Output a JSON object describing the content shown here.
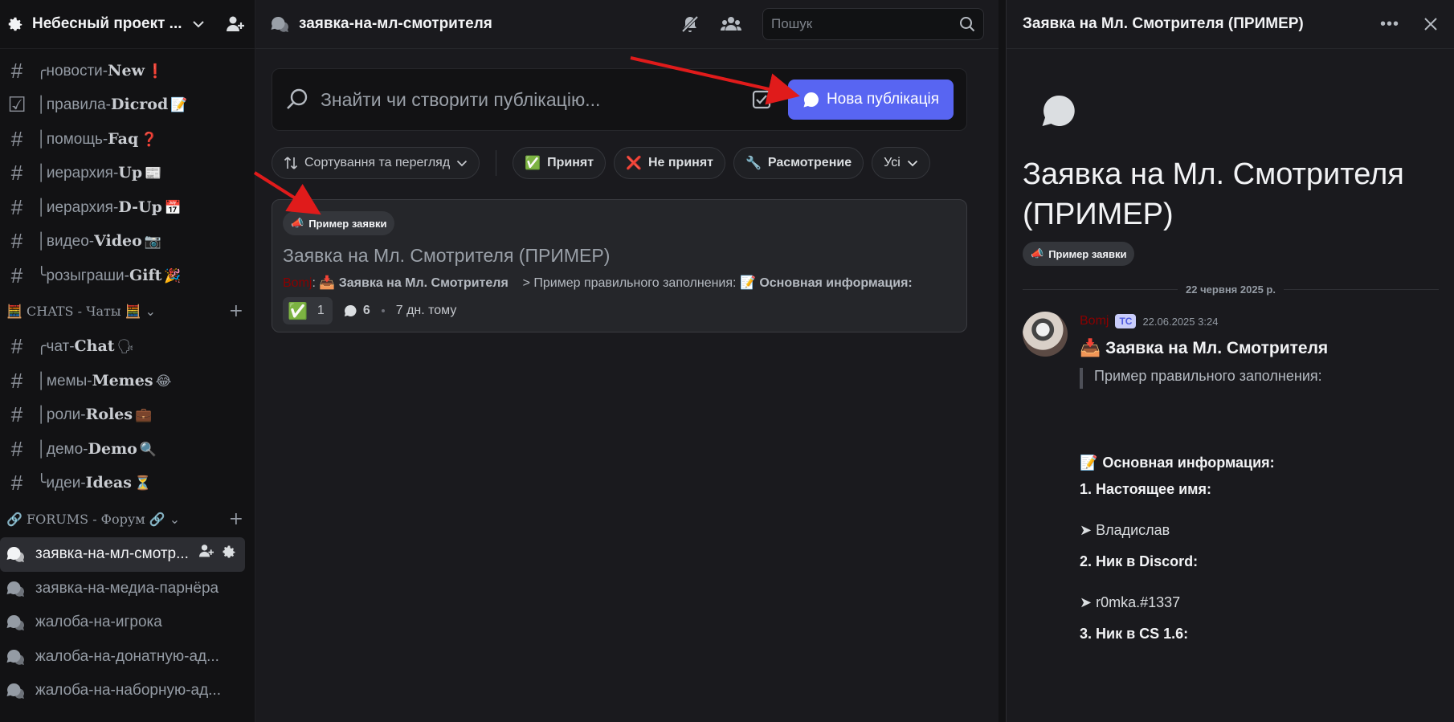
{
  "server": {
    "name": "Небесный проект ..."
  },
  "channels_top": [
    {
      "prefix": "╭",
      "name": "новости-",
      "bold": "New",
      "emoji": "❗"
    },
    {
      "prefix": "│",
      "name": "правила-",
      "bold": "Dicrod",
      "emoji": "📝",
      "icon": "rules"
    },
    {
      "prefix": "│",
      "name": "помощь-",
      "bold": "Faq",
      "emoji": "❓"
    },
    {
      "prefix": "│",
      "name": "иерархия-",
      "bold": "Up",
      "emoji": "📰"
    },
    {
      "prefix": "│",
      "name": "иерархия-",
      "bold": "D-Up",
      "emoji": "📅"
    },
    {
      "prefix": "│",
      "name": "видео-",
      "bold": "Video",
      "emoji": "📷"
    },
    {
      "prefix": "╰",
      "name": "розыграши-",
      "bold": "Gift",
      "emoji": "🎉"
    }
  ],
  "category_chats": {
    "label": "🧮 CHATS - Чаты 🧮 ⌄"
  },
  "channels_chats": [
    {
      "prefix": "╭",
      "name": "чат-",
      "bold": "Chat",
      "emoji": "🗣"
    },
    {
      "prefix": "│",
      "name": "мемы-",
      "bold": "Memes",
      "emoji": "😂"
    },
    {
      "prefix": "│",
      "name": "роли-",
      "bold": "Roles",
      "emoji": "💼"
    },
    {
      "prefix": "│",
      "name": "демо-",
      "bold": "Demo",
      "emoji": "🔍"
    },
    {
      "prefix": "╰",
      "name": "идеи-",
      "bold": "Ideas",
      "emoji": "⏳"
    }
  ],
  "category_forums": {
    "label": "🔗 FORUMS - Форум 🔗 ⌄"
  },
  "forums": [
    {
      "name": "заявка-на-мл-смотр...",
      "active": true
    },
    {
      "name": "заявка-на-медиа-парнёра",
      "active": false
    },
    {
      "name": "жалоба-на-игрока",
      "active": false
    },
    {
      "name": "жалоба-на-донатную-ад...",
      "active": false
    },
    {
      "name": "жалоба-на-наборную-ад...",
      "active": false
    }
  ],
  "main": {
    "channel_title": "заявка-на-мл-смотрителя",
    "search_placeholder": "Пошук",
    "composer_placeholder": "Знайти чи створити публікацію...",
    "new_post_label": "Нова публікація",
    "sort_label": "Сортування та перегляд",
    "tags": [
      {
        "emoji": "✅",
        "label": "Принят"
      },
      {
        "emoji": "❌",
        "label": "Не принят"
      },
      {
        "emoji": "🔧",
        "label": "Расмотрение"
      }
    ],
    "all_label": "Усі",
    "post": {
      "tag": "Пример заявки",
      "title": "Заявка на Мл. Смотрителя (ПРИМЕР)",
      "author": "Bomj",
      "preview_bold": "Заявка на Мл. Смотрителя",
      "preview_rest": "> Пример правильного заполнения:",
      "preview_bold2": "Основная информация:",
      "reaction_count": "1",
      "message_count": "6",
      "age": "7 дн. тому"
    }
  },
  "thread": {
    "header_title": "Заявка на Мл. Смотрителя (ПРИМЕР)",
    "title": "Заявка на Мл. Смотрителя (ПРИМЕР)",
    "tag": "Пример заявки",
    "date_divider": "22 червня 2025 р.",
    "author": "Bomj",
    "op_badge": "TC",
    "timestamp": "22.06.2025 3:24",
    "heading": "Заявка на Мл. Смотрителя",
    "quote": "Пример правильного заполнения:",
    "section": "Основная информация:",
    "fields": [
      {
        "label": "1. Настоящее имя:",
        "value": "➤ Владислав"
      },
      {
        "label": "2. Ник в Discord:",
        "value": "➤ r0mka.#1337"
      },
      {
        "label": "3. Ник в CS 1.6:",
        "value": ""
      }
    ]
  },
  "colors": {
    "accent": "#5865f2",
    "author": "#8b0000",
    "annotation_arrow": "#e01b1b"
  }
}
